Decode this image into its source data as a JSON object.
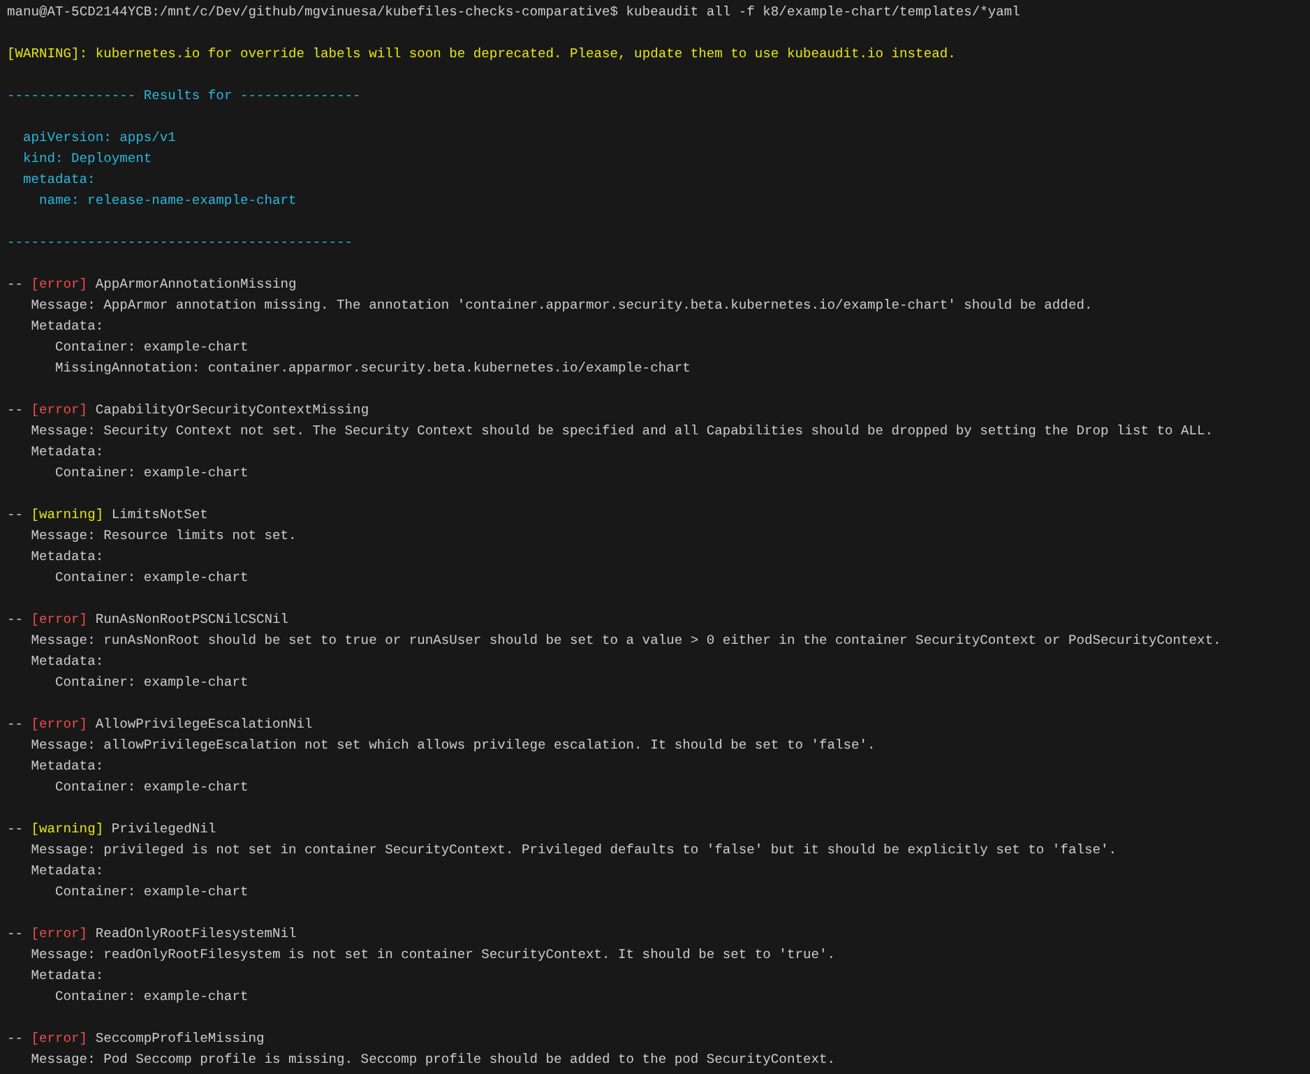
{
  "prompt": {
    "path": "manu@AT-5CD2144YCB:/mnt/c/Dev/github/mgvinuesa/kubefiles-checks-comparative$",
    "command": "kubeaudit all -f k8/example-chart/templates/*yaml"
  },
  "warning": "[WARNING]: kubernetes.io for override labels will soon be deprecated. Please, update them to use kubeaudit.io instead.",
  "results_header": "---------------- Results for ---------------",
  "resource": [
    {
      "text": "apiVersion: apps/v1"
    },
    {
      "text": "kind: Deployment"
    },
    {
      "text": "metadata:",
      "children": [
        {
          "text": "name: release-name-example-chart"
        }
      ]
    }
  ],
  "separator": "-------------------------------------------",
  "findings": [
    {
      "marker": "--",
      "kind": "error",
      "tag": "[error]",
      "name": "AppArmorAnnotationMissing",
      "message": "Message: AppArmor annotation missing. The annotation 'container.apparmor.security.beta.kubernetes.io/example-chart' should be added.",
      "metadata_label": "Metadata:",
      "metadata": [
        "Container: example-chart",
        "MissingAnnotation: container.apparmor.security.beta.kubernetes.io/example-chart"
      ]
    },
    {
      "marker": "--",
      "kind": "error",
      "tag": "[error]",
      "name": "CapabilityOrSecurityContextMissing",
      "message": "Message: Security Context not set. The Security Context should be specified and all Capabilities should be dropped by setting the Drop list to ALL.",
      "metadata_label": "Metadata:",
      "metadata": [
        "Container: example-chart"
      ]
    },
    {
      "marker": "--",
      "kind": "warning",
      "tag": "[warning]",
      "name": "LimitsNotSet",
      "message": "Message: Resource limits not set.",
      "metadata_label": "Metadata:",
      "metadata": [
        "Container: example-chart"
      ]
    },
    {
      "marker": "--",
      "kind": "error",
      "tag": "[error]",
      "name": "RunAsNonRootPSCNilCSCNil",
      "message": "Message: runAsNonRoot should be set to true or runAsUser should be set to a value > 0 either in the container SecurityContext or PodSecurityContext.",
      "metadata_label": "Metadata:",
      "metadata": [
        "Container: example-chart"
      ]
    },
    {
      "marker": "--",
      "kind": "error",
      "tag": "[error]",
      "name": "AllowPrivilegeEscalationNil",
      "message": "Message: allowPrivilegeEscalation not set which allows privilege escalation. It should be set to 'false'.",
      "metadata_label": "Metadata:",
      "metadata": [
        "Container: example-chart"
      ]
    },
    {
      "marker": "--",
      "kind": "warning",
      "tag": "[warning]",
      "name": "PrivilegedNil",
      "message": "Message: privileged is not set in container SecurityContext. Privileged defaults to 'false' but it should be explicitly set to 'false'.",
      "metadata_label": "Metadata:",
      "metadata": [
        "Container: example-chart"
      ]
    },
    {
      "marker": "--",
      "kind": "error",
      "tag": "[error]",
      "name": "ReadOnlyRootFilesystemNil",
      "message": "Message: readOnlyRootFilesystem is not set in container SecurityContext. It should be set to 'true'.",
      "metadata_label": "Metadata:",
      "metadata": [
        "Container: example-chart"
      ]
    },
    {
      "marker": "--",
      "kind": "error",
      "tag": "[error]",
      "name": "SeccompProfileMissing",
      "message": "Message: Pod Seccomp profile is missing. Seccomp profile should be added to the pod SecurityContext."
    }
  ]
}
